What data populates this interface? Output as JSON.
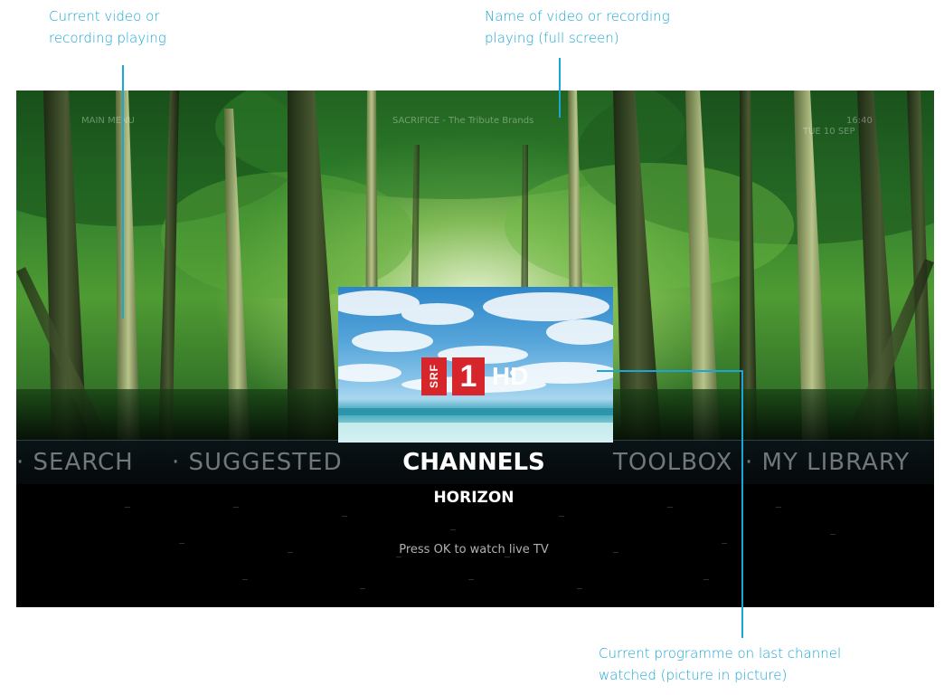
{
  "callouts": {
    "current_video": "Current video or\nrecording playing",
    "name_of_video": "Name of video or recording\nplaying (full screen)",
    "current_programme": "Current programme on last channel\nwatched (picture in picture)"
  },
  "screen": {
    "top_left": "MAIN MENU",
    "top_center": "SACRIFICE - The Tribute Brands",
    "top_right_time": "16:40",
    "top_right_date": "TUE 10 SEP"
  },
  "menu": {
    "items_left": [
      "· SEARCH",
      "· SUGGESTED"
    ],
    "active": "CHANNELS",
    "items_right": [
      "TOOLBOX",
      "· MY LIBRARY"
    ],
    "subtitle": "HORIZON",
    "hint": "Press OK to watch live TV"
  },
  "pip": {
    "channel_logo_srf": "SRF",
    "channel_logo_number": "1",
    "channel_logo_hd": "HD"
  },
  "colors": {
    "callout": "#1aa6d6",
    "logo_red": "#d7262b"
  }
}
